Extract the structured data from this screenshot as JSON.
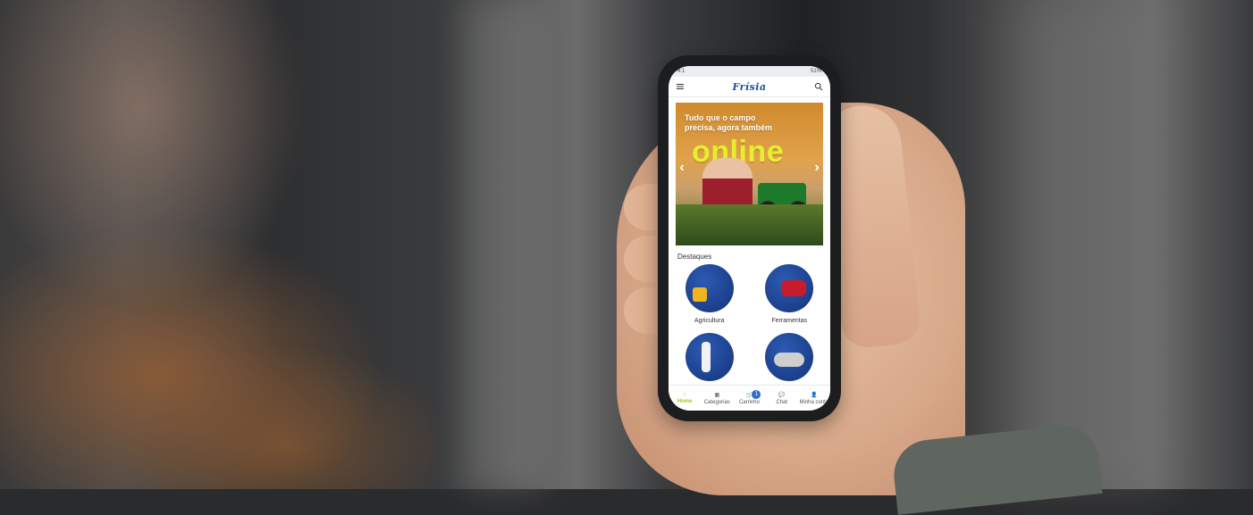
{
  "app": {
    "brand": "Frísia",
    "banner": {
      "line1": "Tudo que o campo",
      "line2": "precisa, agora também",
      "online_word": "online"
    },
    "highlights": {
      "title": "Destaques",
      "categories": [
        {
          "label": "Agricultura",
          "icon": "agriculture-icon"
        },
        {
          "label": "Ferramentas",
          "icon": "tools-icon"
        },
        {
          "label": "",
          "icon": "category-3-icon"
        },
        {
          "label": "",
          "icon": "category-4-icon"
        }
      ]
    },
    "bottom_nav": [
      {
        "label": "Home",
        "icon": "home-icon"
      },
      {
        "label": "Categorias",
        "icon": "categories-icon"
      },
      {
        "label": "Carrinho",
        "icon": "cart-icon",
        "badge": "1"
      },
      {
        "label": "Chat",
        "icon": "chat-icon"
      },
      {
        "label": "Minha conta",
        "icon": "account-icon"
      }
    ]
  },
  "status_bar": {
    "left": "4:1",
    "right": "51%"
  },
  "colors": {
    "brand_blue": "#1d4f9c",
    "accent_green": "#9acb2a",
    "online_yellow": "#e6ef2d",
    "category_blue": "#1c3f8a"
  }
}
